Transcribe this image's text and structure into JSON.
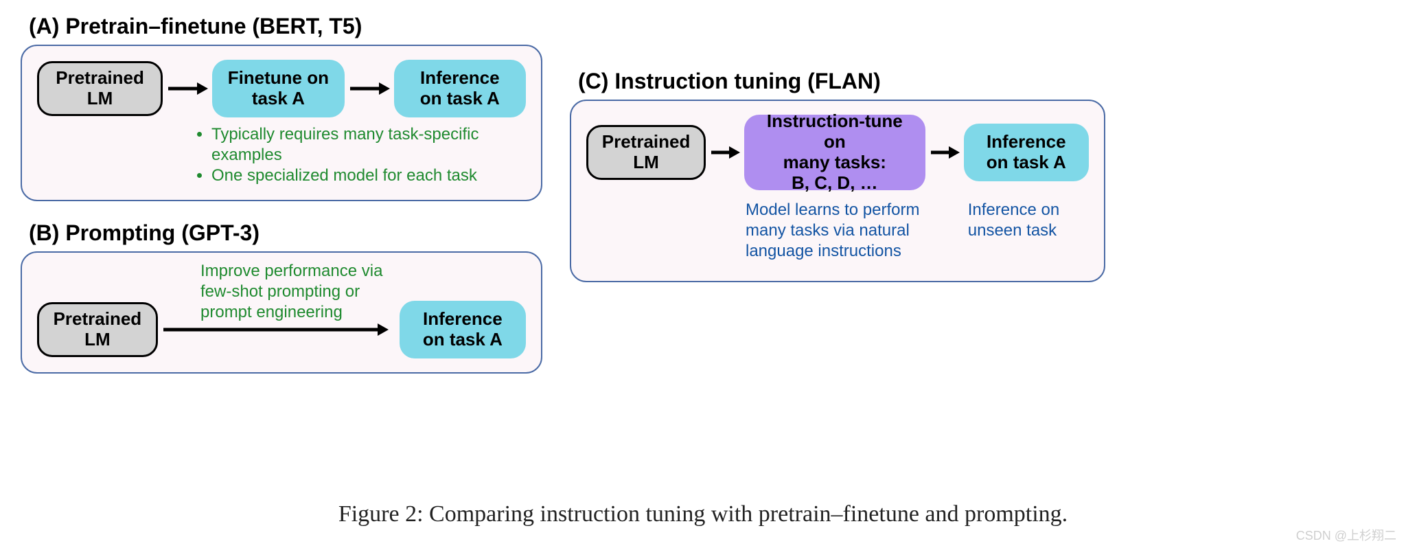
{
  "panelA": {
    "title": "(A) Pretrain–finetune (BERT, T5)",
    "node1": "Pretrained\nLM",
    "node2": "Finetune on\ntask A",
    "node3": "Inference\non task A",
    "bullet1": "Typically requires many task-specific examples",
    "bullet2": "One specialized model for each task"
  },
  "panelB": {
    "title": "(B) Prompting (GPT-3)",
    "node1": "Pretrained\nLM",
    "note": "Improve performance via few-shot prompting or prompt engineering",
    "node2": "Inference\non task A"
  },
  "panelC": {
    "title": "(C) Instruction tuning (FLAN)",
    "node1": "Pretrained\nLM",
    "node2": "Instruction-tune on\nmany tasks:\nB, C, D, …",
    "node3": "Inference\non task A",
    "note1": "Model learns to perform many tasks via natural language instructions",
    "note2": "Inference on unseen task"
  },
  "caption": "Figure 2: Comparing instruction tuning with pretrain–finetune and prompting.",
  "watermark": "CSDN @上杉翔二"
}
